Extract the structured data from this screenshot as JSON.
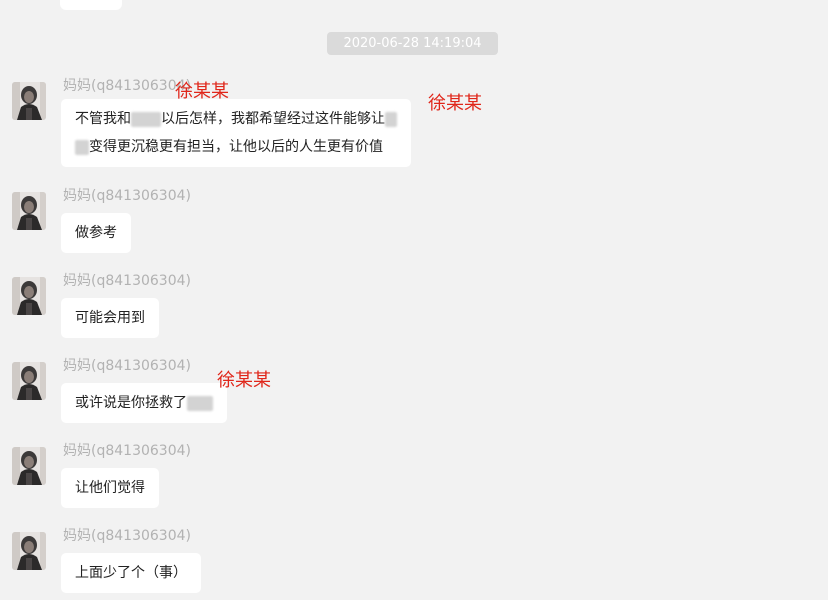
{
  "timestamp": "2020-06-28 14:19:04",
  "messages": [
    {
      "sender": "妈妈(q841306304)",
      "line1_a": "不管我和",
      "line1_b": "以后怎样，我都希望经过这件能够让",
      "line2": "变得更沉稳更有担当，让他以后的人生更有价值"
    },
    {
      "sender": "妈妈(q841306304)",
      "text": "做参考"
    },
    {
      "sender": "妈妈(q841306304)",
      "text": "可能会用到"
    },
    {
      "sender": "妈妈(q841306304)",
      "text": "或许说是你拯救了"
    },
    {
      "sender": "妈妈(q841306304)",
      "text": "让他们觉得"
    },
    {
      "sender": "妈妈(q841306304)",
      "text": "上面少了个（事）"
    }
  ],
  "annotations": [
    "徐某某",
    "徐某某",
    "徐某某"
  ],
  "colors": {
    "annotation": "#e0261a",
    "bubble": "#ffffff",
    "background": "#f2f2f2"
  }
}
